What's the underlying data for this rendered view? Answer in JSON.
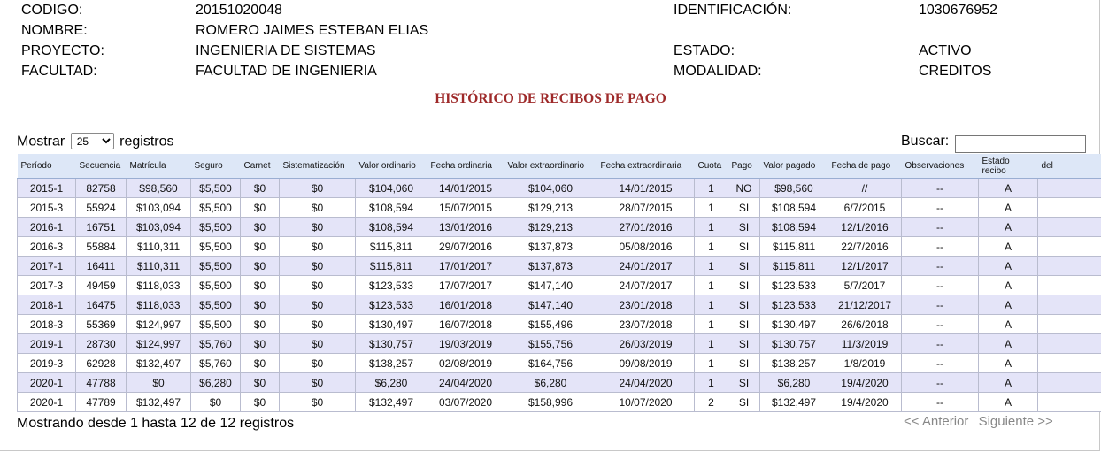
{
  "student": {
    "codigo_label": "CODIGO:",
    "codigo": "20151020048",
    "identificacion_label": "IDENTIFICACIÓN:",
    "identificacion": "1030676952",
    "nombre_label": "NOMBRE:",
    "nombre": "ROMERO JAIMES ESTEBAN ELIAS",
    "proyecto_label": "PROYECTO:",
    "proyecto": "INGENIERIA DE SISTEMAS",
    "estado_label": "ESTADO:",
    "estado": "ACTIVO",
    "facultad_label": "FACULTAD:",
    "facultad": "FACULTAD DE INGENIERIA",
    "modalidad_label": "MODALIDAD:",
    "modalidad": "CREDITOS"
  },
  "title": "HISTÓRICO DE RECIBOS DE PAGO",
  "controls": {
    "show_prefix": "Mostrar",
    "show_value": "25",
    "show_suffix": "registros",
    "search_label": "Buscar:",
    "search_value": ""
  },
  "table": {
    "headers": [
      "Período",
      "Secuencia",
      "Matrícula",
      "Seguro",
      "Carnet",
      "Sistematización",
      "Valor ordinario",
      "Fecha ordinaria",
      "Valor extraordinario",
      "Fecha extraordinaria",
      "Cuota",
      "Pago",
      "Valor pagado",
      "Fecha de pago",
      "Observaciones",
      "Estado recibo",
      "del"
    ],
    "rows": [
      [
        "2015-1",
        "82758",
        "$98,560",
        "$5,500",
        "$0",
        "$0",
        "$104,060",
        "14/01/2015",
        "$104,060",
        "14/01/2015",
        "1",
        "NO",
        "$98,560",
        "//",
        "--",
        "A",
        ""
      ],
      [
        "2015-3",
        "55924",
        "$103,094",
        "$5,500",
        "$0",
        "$0",
        "$108,594",
        "15/07/2015",
        "$129,213",
        "28/07/2015",
        "1",
        "SI",
        "$108,594",
        "6/7/2015",
        "--",
        "A",
        ""
      ],
      [
        "2016-1",
        "16751",
        "$103,094",
        "$5,500",
        "$0",
        "$0",
        "$108,594",
        "13/01/2016",
        "$129,213",
        "27/01/2016",
        "1",
        "SI",
        "$108,594",
        "12/1/2016",
        "--",
        "A",
        ""
      ],
      [
        "2016-3",
        "55884",
        "$110,311",
        "$5,500",
        "$0",
        "$0",
        "$115,811",
        "29/07/2016",
        "$137,873",
        "05/08/2016",
        "1",
        "SI",
        "$115,811",
        "22/7/2016",
        "--",
        "A",
        ""
      ],
      [
        "2017-1",
        "16411",
        "$110,311",
        "$5,500",
        "$0",
        "$0",
        "$115,811",
        "17/01/2017",
        "$137,873",
        "24/01/2017",
        "1",
        "SI",
        "$115,811",
        "12/1/2017",
        "--",
        "A",
        ""
      ],
      [
        "2017-3",
        "49459",
        "$118,033",
        "$5,500",
        "$0",
        "$0",
        "$123,533",
        "17/07/2017",
        "$147,140",
        "24/07/2017",
        "1",
        "SI",
        "$123,533",
        "5/7/2017",
        "--",
        "A",
        ""
      ],
      [
        "2018-1",
        "16475",
        "$118,033",
        "$5,500",
        "$0",
        "$0",
        "$123,533",
        "16/01/2018",
        "$147,140",
        "23/01/2018",
        "1",
        "SI",
        "$123,533",
        "21/12/2017",
        "--",
        "A",
        ""
      ],
      [
        "2018-3",
        "55369",
        "$124,997",
        "$5,500",
        "$0",
        "$0",
        "$130,497",
        "16/07/2018",
        "$155,496",
        "23/07/2018",
        "1",
        "SI",
        "$130,497",
        "26/6/2018",
        "--",
        "A",
        ""
      ],
      [
        "2019-1",
        "28730",
        "$124,997",
        "$5,760",
        "$0",
        "$0",
        "$130,757",
        "19/03/2019",
        "$155,756",
        "26/03/2019",
        "1",
        "SI",
        "$130,757",
        "11/3/2019",
        "--",
        "A",
        ""
      ],
      [
        "2019-3",
        "62928",
        "$132,497",
        "$5,760",
        "$0",
        "$0",
        "$138,257",
        "02/08/2019",
        "$164,756",
        "09/08/2019",
        "1",
        "SI",
        "$138,257",
        "1/8/2019",
        "--",
        "A",
        ""
      ],
      [
        "2020-1",
        "47788",
        "$0",
        "$6,280",
        "$0",
        "$0",
        "$6,280",
        "24/04/2020",
        "$6,280",
        "24/04/2020",
        "1",
        "SI",
        "$6,280",
        "19/4/2020",
        "--",
        "A",
        ""
      ],
      [
        "2020-1",
        "47789",
        "$132,497",
        "$0",
        "$0",
        "$0",
        "$132,497",
        "03/07/2020",
        "$158,996",
        "10/07/2020",
        "2",
        "SI",
        "$132,497",
        "19/4/2020",
        "--",
        "A",
        ""
      ]
    ]
  },
  "footer": {
    "info": "Mostrando desde 1 hasta 12 de 12 registros",
    "prev": "<< Anterior",
    "next": "Siguiente >>"
  }
}
